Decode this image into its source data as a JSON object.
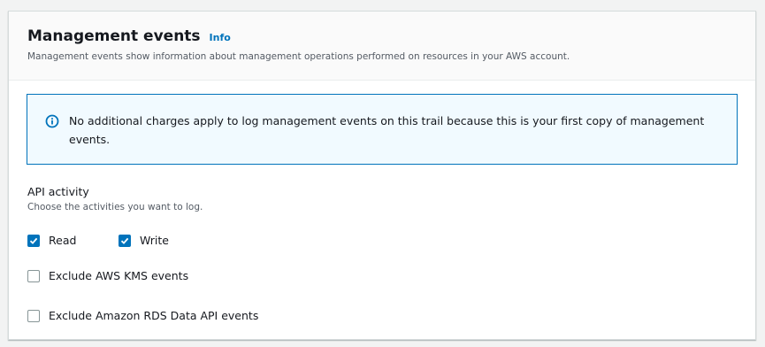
{
  "panel": {
    "title": "Management events",
    "info_label": "Info",
    "description": "Management events show information about management operations performed on resources in your AWS account."
  },
  "alert": {
    "icon": "info-icon",
    "text": "No additional charges apply to log management events on this trail because this is your first copy of management events."
  },
  "api_activity": {
    "label": "API activity",
    "description": "Choose the activities you want to log.",
    "read": {
      "label": "Read",
      "checked": true
    },
    "write": {
      "label": "Write",
      "checked": true
    }
  },
  "exclusions": {
    "kms": {
      "label": "Exclude AWS KMS events",
      "checked": false
    },
    "rds": {
      "label": "Exclude Amazon RDS Data API events",
      "checked": false
    }
  },
  "colors": {
    "accent": "#0073bb",
    "alert_bg": "#f1faff"
  }
}
